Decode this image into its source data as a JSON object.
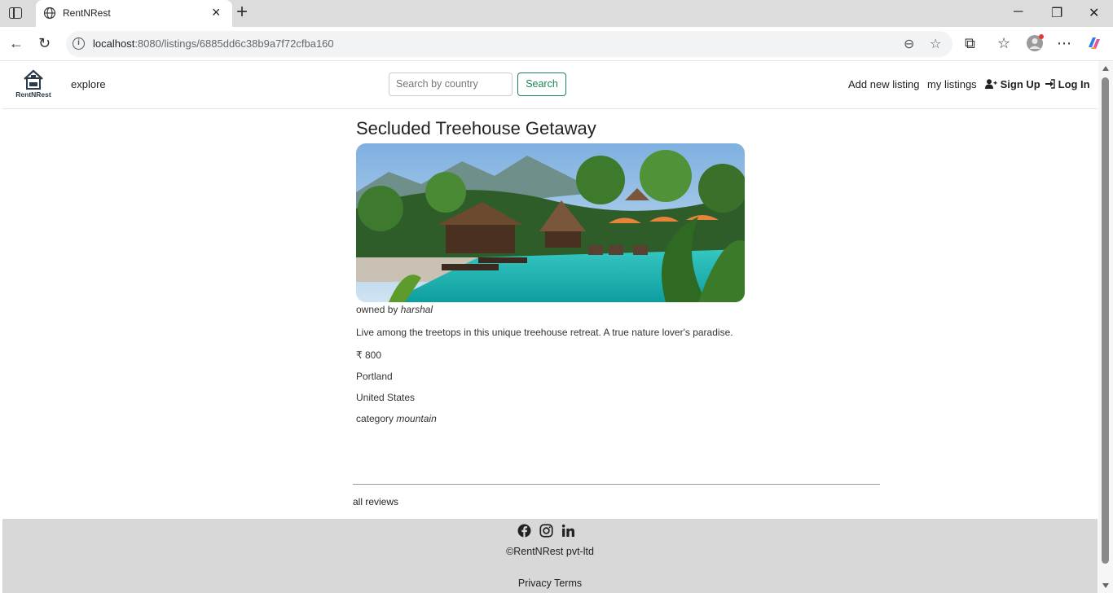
{
  "browser": {
    "tab_title": "RentNRest",
    "url_host": "localhost",
    "url_rest": ":8080/listings/6885dd6c38b9a7f72cfba160"
  },
  "navbar": {
    "brand": "RentNRest",
    "explore": "explore",
    "search_placeholder": "Search by country",
    "search_button": "Search",
    "add_listing": "Add new listing",
    "my_listings": "my listings",
    "sign_up": "Sign Up",
    "log_in": "Log In"
  },
  "listing": {
    "title": "Secluded Treehouse Getaway",
    "owner_prefix": "owned by",
    "owner": "harshal",
    "description": "Live among the treetops in this unique treehouse retreat. A true nature lover's paradise.",
    "price": "₹ 800",
    "location": "Portland",
    "country": "United States",
    "category_prefix": "category",
    "category": "mountain"
  },
  "reviews": {
    "heading": "all reviews"
  },
  "footer": {
    "copyright": "©RentNRest pvt-ltd",
    "legal": "Privacy Terms"
  },
  "colors": {
    "accent": "#198754",
    "footer_bg": "#d8d8d8"
  }
}
